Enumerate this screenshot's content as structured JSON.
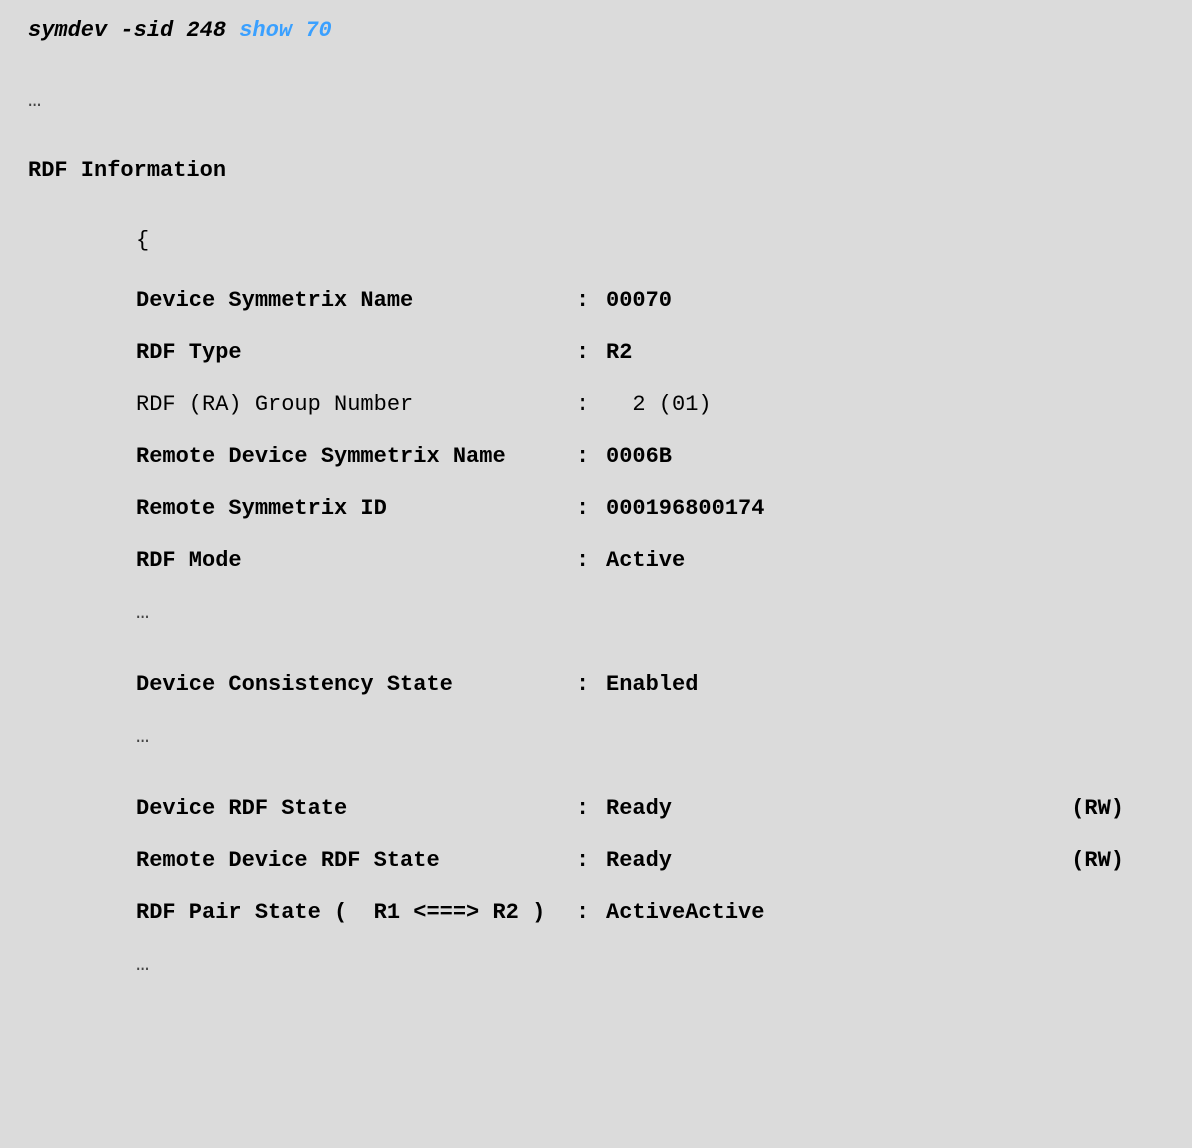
{
  "command": {
    "base": "symdev -sid 248 ",
    "highlight": "show 70"
  },
  "ellipsis": "…",
  "section_title": "RDF Information",
  "brace": "{",
  "rows": {
    "dev_sym_name": {
      "label": "Device Symmetrix Name",
      "value": "00070"
    },
    "rdf_type": {
      "label": "RDF Type",
      "value": "R2"
    },
    "ra_group": {
      "label": "RDF (RA) Group Number",
      "value": "  2 (01)"
    },
    "remote_dev": {
      "label": "Remote Device Symmetrix Name",
      "value": "0006B"
    },
    "remote_sid": {
      "label": "Remote Symmetrix ID",
      "value": "000196800174"
    },
    "rdf_mode": {
      "label": "RDF Mode",
      "value": "Active"
    },
    "consistency": {
      "label": "Device Consistency State",
      "value": "Enabled"
    },
    "dev_rdf_state": {
      "label": "Device RDF State",
      "value": "Ready",
      "suffix": "(RW)"
    },
    "rem_rdf_state": {
      "label": "Remote Device RDF State",
      "value": "Ready",
      "suffix": "(RW)"
    },
    "pair_state": {
      "label": "RDF Pair State (  R1 <===> R2 )",
      "value": "ActiveActive"
    }
  }
}
